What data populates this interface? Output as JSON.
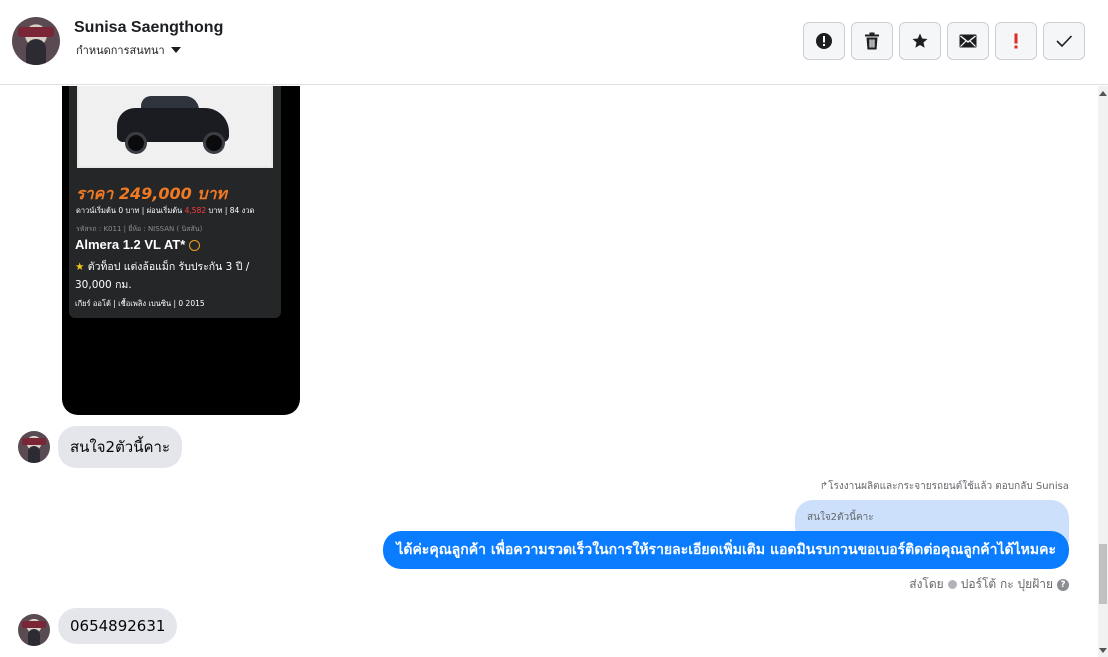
{
  "header": {
    "contact_name": "Sunisa Saengthong",
    "assign_label": "กำหนดการสนทนา",
    "actions": [
      {
        "name": "report-button",
        "icon": "exclamation-circle-icon",
        "color": "#1c1e21"
      },
      {
        "name": "delete-button",
        "icon": "trash-icon",
        "color": "#1c1e21"
      },
      {
        "name": "star-button",
        "icon": "star-icon",
        "color": "#1c1e21"
      },
      {
        "name": "mark-unread-button",
        "icon": "envelope-icon",
        "color": "#1c1e21"
      },
      {
        "name": "follow-up-button",
        "icon": "exclamation-icon",
        "color": "#e02a20"
      },
      {
        "name": "done-button",
        "icon": "check-icon",
        "color": "#1c1e21"
      }
    ]
  },
  "shared_image": {
    "price": "ราคา 249,000 บาท",
    "terms_before": "ดาวน์เริ่มต้น 0 บาท | ผ่อนเริ่มต้น ",
    "terms_highlight": "4,582",
    "terms_after": " บาท | 84 งวด",
    "meta": "รหัสรถ : K011 | ยี่ห้อ : NISSAN ( นิสสัน)",
    "model": "Almera 1.2 VL AT*",
    "promo": "ตัวท็อป แต่งล้อแม็ก รับประกัน 3 ปี / 30,000 กม.",
    "specs": "เกียร์ ออโต้   |   เชื้อเพลิง เบนซิน   |   0 2015"
  },
  "messages": {
    "incoming_1": "สนใจ2ตัวนี้คาะ",
    "reply_note": "โรงงานผลิตและกระจายรถยนต์ใช้แล้ว ตอบกลับ Sunisa",
    "quoted_text": "สนใจ2ตัวนี้คาะ",
    "outgoing_1": "ได้ค่ะคุณลูกค้า เพื่อความรวดเร็วในการให้รายละเอียดเพิ่มเติม แอดมินรบกวนขอเบอร์ติดต่อคุณลูกค้าได้ไหมคะ",
    "sent_by_label": "ส่งโดย",
    "sent_by_name": "ปอร์โต้ กะ ปุยฝ้าย",
    "incoming_2": "0654892631"
  },
  "colors": {
    "outgoing_bubble": "#0a7cff",
    "incoming_bubble": "#e4e6eb",
    "quoted_bubble": "#cce0fb",
    "price": "#f07a24"
  }
}
